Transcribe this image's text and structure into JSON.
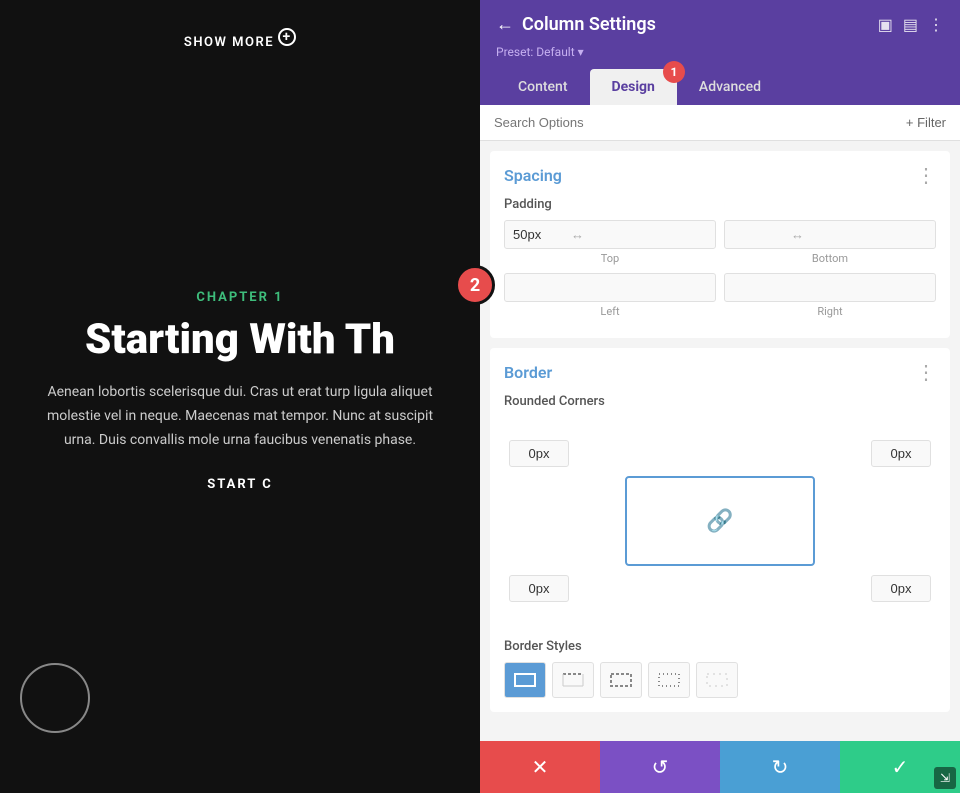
{
  "left": {
    "show_more": "SHOW MORE",
    "chapter_label": "CHAPTER 1",
    "chapter_title": "Starting With Th",
    "chapter_body": "Aenean lobortis scelerisque dui. Cras ut erat turp ligula aliquet molestie vel in neque. Maecenas mat tempor. Nunc at suscipit urna. Duis convallis mole urna faucibus venenatis phase.",
    "cta": "START C"
  },
  "panel": {
    "title": "Column Settings",
    "preset": "Preset: Default ▾",
    "tabs": [
      {
        "label": "Content",
        "active": false
      },
      {
        "label": "Design",
        "active": true
      },
      {
        "label": "Advanced",
        "active": false
      }
    ],
    "search_placeholder": "Search Options",
    "filter_label": "+ Filter",
    "spacing": {
      "title": "Spacing",
      "padding_label": "Padding",
      "top_value": "50px",
      "bottom_value": "",
      "left_value": "",
      "right_value": "",
      "labels": [
        "Top",
        "Bottom",
        "Left",
        "Right"
      ]
    },
    "border": {
      "title": "Border",
      "rounded_corners_label": "Rounded Corners",
      "corners": [
        "0px",
        "0px",
        "0px",
        "0px"
      ],
      "border_styles_label": "Border Styles"
    },
    "toolbar": {
      "cancel": "✕",
      "undo": "↺",
      "redo": "↻",
      "save": "✓"
    }
  },
  "step1": "1",
  "step2": "2"
}
